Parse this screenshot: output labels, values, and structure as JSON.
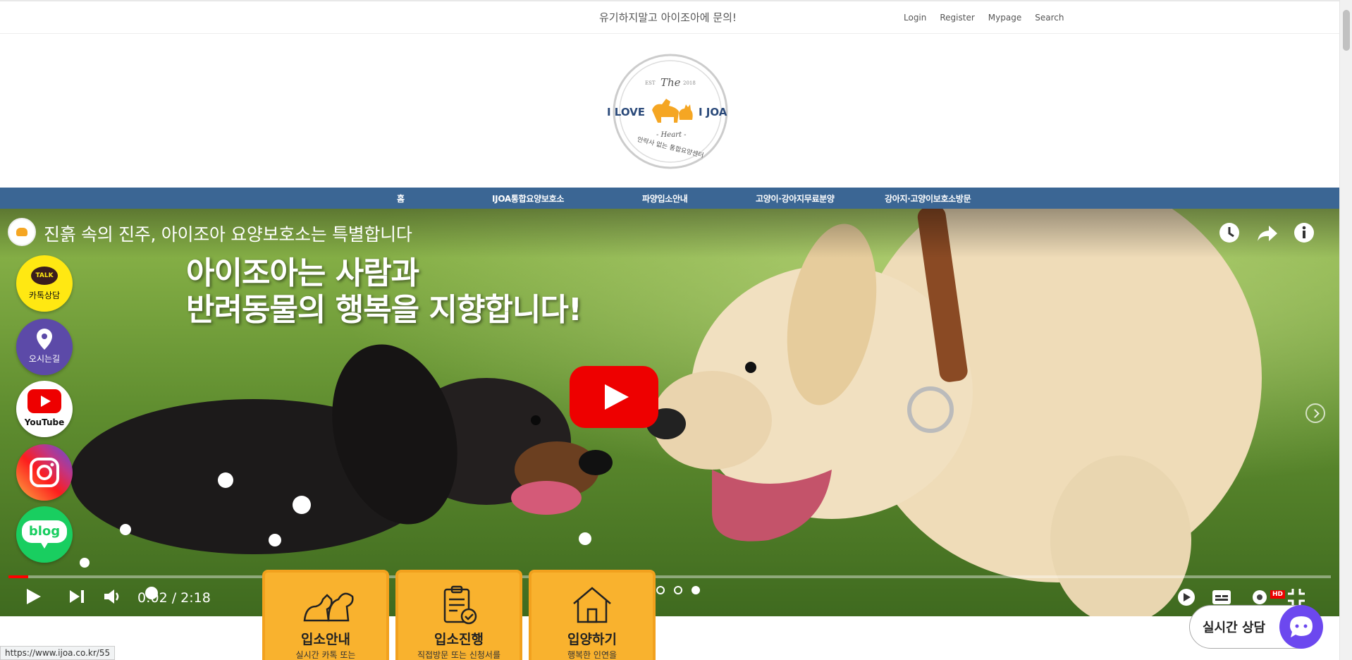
{
  "topbar": {
    "notice": "유기하지말고 아이조아에 문의!",
    "links": [
      "Login",
      "Register",
      "Mypage",
      "Search"
    ]
  },
  "logo": {
    "est": "EST",
    "the": "The",
    "year": "2018",
    "left": "I LOVE",
    "right": "I JOA",
    "heart": "- Heart -",
    "slogan": "안락사 없는 통합요양센터"
  },
  "nav": {
    "items": [
      "홈",
      "IJOA통합요양보호소",
      "파양입소안내",
      "고양이·강아지무료분양",
      "강아지·고양이보호소방문"
    ]
  },
  "video": {
    "title": "진흙 속의 진주, 아이조아 요양보호소는 특별합니다",
    "overlay_line1": "아이조아는 사람과",
    "overlay_line2": "반려동물의 행복을 지향합니다!",
    "timecode": "0:02 / 2:18",
    "progress": 0.015,
    "hd": "HD"
  },
  "social": {
    "talk_badge": "TALK",
    "talk_label": "카톡상담",
    "location_label": "오시는길",
    "youtube_label": "YouTube",
    "blog_label": "blog"
  },
  "cards": [
    {
      "title": "입소안내",
      "desc": "실시간 카톡 또는"
    },
    {
      "title": "입소진행",
      "desc": "직접방문 또는 신청서를"
    },
    {
      "title": "입양하기",
      "desc": "행복한 인연을"
    }
  ],
  "statusbar": {
    "url": "https://www.ijoa.co.kr/55"
  },
  "chat": {
    "label": "실시간 상담"
  },
  "colors": {
    "nav": "#3b6694",
    "card": "#f9b22e",
    "chat": "#6c48ef",
    "accent": "#f5a623"
  }
}
